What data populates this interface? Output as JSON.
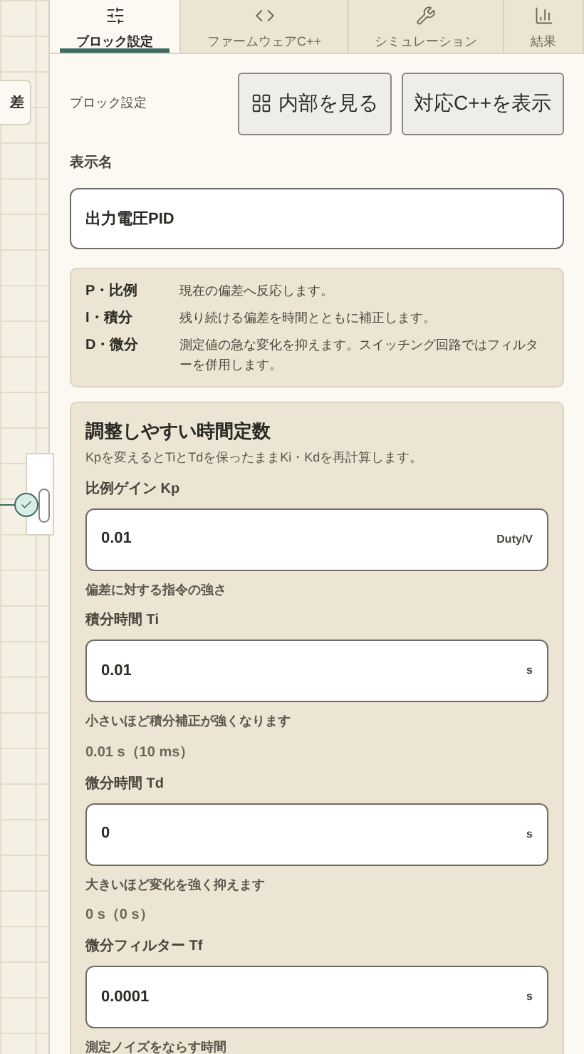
{
  "canvas": {
    "node_label": "差"
  },
  "tabs": [
    {
      "label": "ブロック設定",
      "selected": true
    },
    {
      "label": "ファームウェアC++",
      "selected": false
    },
    {
      "label": "シミュレーション",
      "selected": false
    },
    {
      "label": "結果",
      "selected": false
    }
  ],
  "header": {
    "title": "ブロック設定",
    "buttons": [
      {
        "label": "内部を見る"
      },
      {
        "label": "対応C++を表示"
      }
    ]
  },
  "display_name": {
    "label": "表示名",
    "value": "出力電圧PID"
  },
  "legend": [
    {
      "term": "P・比例",
      "desc": "現在の偏差へ反応します。"
    },
    {
      "term": "I・積分",
      "desc": "残り続ける偏差を時間とともに補正します。"
    },
    {
      "term": "D・微分",
      "desc": "測定値の急な変化を抑えます。スイッチング回路ではフィルターを併用します。"
    }
  ],
  "tuning": {
    "title": "調整しやすい時間定数",
    "subtitle": "Kpを変えるとTiとTdを保ったままKi・Kdを再計算します。",
    "fields": [
      {
        "label": "比例ゲイン Kp",
        "value": "0.01",
        "unit": "Duty/V",
        "hint": "偏差に対する指令の強さ"
      },
      {
        "label": "積分時間 Ti",
        "value": "0.01",
        "unit": "s",
        "hint": "小さいほど積分補正が強くなります",
        "reading": "0.01 s（10 ms）"
      },
      {
        "label": "微分時間 Td",
        "value": "0",
        "unit": "s",
        "hint": "大きいほど変化を強く抑えます",
        "reading": "0 s（0 s）"
      },
      {
        "label": "微分フィルター Tf",
        "value": "0.0001",
        "unit": "s",
        "hint": "測定ノイズをならす時間"
      }
    ]
  }
}
